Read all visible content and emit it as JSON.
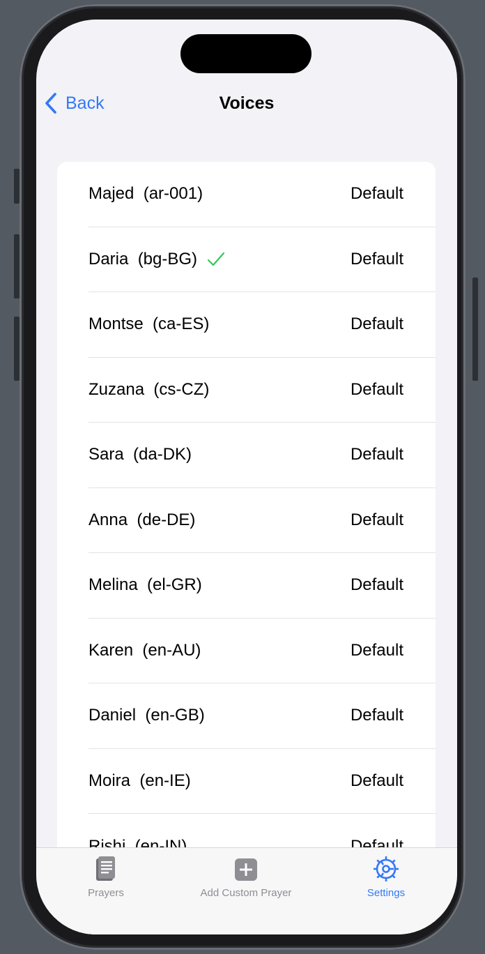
{
  "nav": {
    "back_label": "Back",
    "title": "Voices"
  },
  "voices": [
    {
      "name": "Majed  (ar-001)",
      "quality": "Default",
      "selected": false
    },
    {
      "name": "Daria  (bg-BG)",
      "quality": "Default",
      "selected": true
    },
    {
      "name": "Montse  (ca-ES)",
      "quality": "Default",
      "selected": false
    },
    {
      "name": "Zuzana  (cs-CZ)",
      "quality": "Default",
      "selected": false
    },
    {
      "name": "Sara  (da-DK)",
      "quality": "Default",
      "selected": false
    },
    {
      "name": "Anna  (de-DE)",
      "quality": "Default",
      "selected": false
    },
    {
      "name": "Melina  (el-GR)",
      "quality": "Default",
      "selected": false
    },
    {
      "name": "Karen  (en-AU)",
      "quality": "Default",
      "selected": false
    },
    {
      "name": "Daniel  (en-GB)",
      "quality": "Default",
      "selected": false
    },
    {
      "name": "Moira  (en-IE)",
      "quality": "Default",
      "selected": false
    },
    {
      "name": "Rishi  (en-IN)",
      "quality": "Default",
      "selected": false
    }
  ],
  "tabs": [
    {
      "label": "Prayers",
      "icon": "prayers-book-icon",
      "active": false
    },
    {
      "label": "Add Custom Prayer",
      "icon": "plus-square-icon",
      "active": false
    },
    {
      "label": "Settings",
      "icon": "gear-icon",
      "active": true
    }
  ],
  "colors": {
    "accent": "#3478f6",
    "check": "#34c759",
    "inactive_tab": "#8e8e93"
  }
}
